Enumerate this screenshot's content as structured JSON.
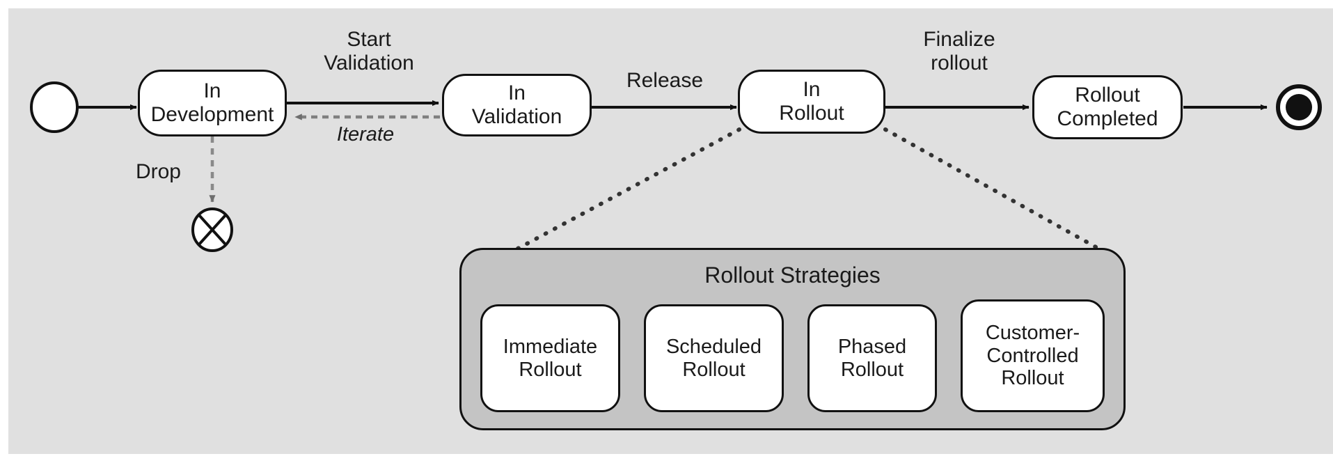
{
  "diagram": {
    "type": "uml-state-machine",
    "title": "Rollout Strategies",
    "background_color": "#e0e0e0",
    "composite_fill": "#c4c4c4",
    "state_fill": "#ffffff",
    "stroke_color": "#111111",
    "dashed_stroke_color": "#808080"
  },
  "states": {
    "initial": {
      "name": "initial-state",
      "label": ""
    },
    "in_development": {
      "label": "In\nDevelopment",
      "line1": "In",
      "line2": "Development"
    },
    "in_validation": {
      "label": "In\nValidation",
      "line1": "In",
      "line2": "Validation"
    },
    "in_rollout": {
      "label": "In\nRollout",
      "line1": "In",
      "line2": "Rollout"
    },
    "rollout_completed": {
      "label": "Rollout\nCompleted",
      "line1": "Rollout",
      "line2": "Completed"
    },
    "terminate": {
      "name": "terminate-node",
      "label": ""
    },
    "final": {
      "name": "final-state",
      "label": ""
    }
  },
  "transitions": {
    "start_validation": "Start\nValidation",
    "iterate": "Iterate",
    "release": "Release",
    "finalize_rollout": "Finalize\nrollout",
    "drop": "Drop"
  },
  "composite": {
    "title": "Rollout Strategies",
    "substates": [
      {
        "line1": "Immediate",
        "line2": "Rollout",
        "label": "Immediate Rollout"
      },
      {
        "line1": "Scheduled",
        "line2": "Rollout",
        "label": "Scheduled Rollout"
      },
      {
        "line1": "Phased",
        "line2": "Rollout",
        "label": "Phased Rollout"
      },
      {
        "line1": "Customer-",
        "line2": "Controlled",
        "line3": "Rollout",
        "label": "Customer-Controlled Rollout"
      }
    ]
  }
}
